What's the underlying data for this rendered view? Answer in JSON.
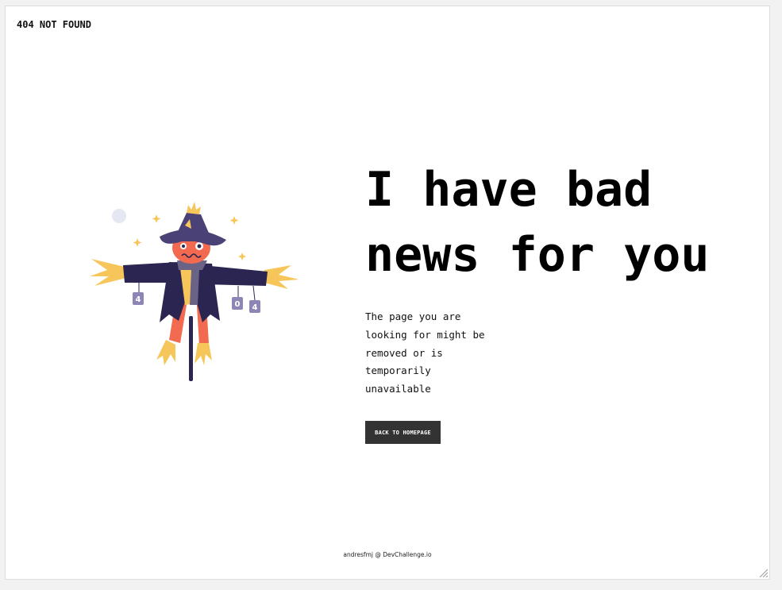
{
  "header": {
    "brand": "404 NOT FOUND"
  },
  "main": {
    "headline": "I have bad news for you",
    "description": "The page you are looking for might be removed or is temporarily unavailable",
    "button_label": "BACK TO HOMEPAGE"
  },
  "illustration": {
    "name": "scarecrow",
    "sign_left": "4",
    "sign_mid": "0",
    "sign_right": "4"
  },
  "footer": {
    "credit": "andresfmj @ DevChallenge.io"
  },
  "colors": {
    "coat": "#2b2552",
    "face": "#f26a4f",
    "straw": "#f7c65a",
    "hat": "#4a4276",
    "scarf": "#6b6386",
    "button_bg": "#333333",
    "moon": "#e3e8f2"
  }
}
